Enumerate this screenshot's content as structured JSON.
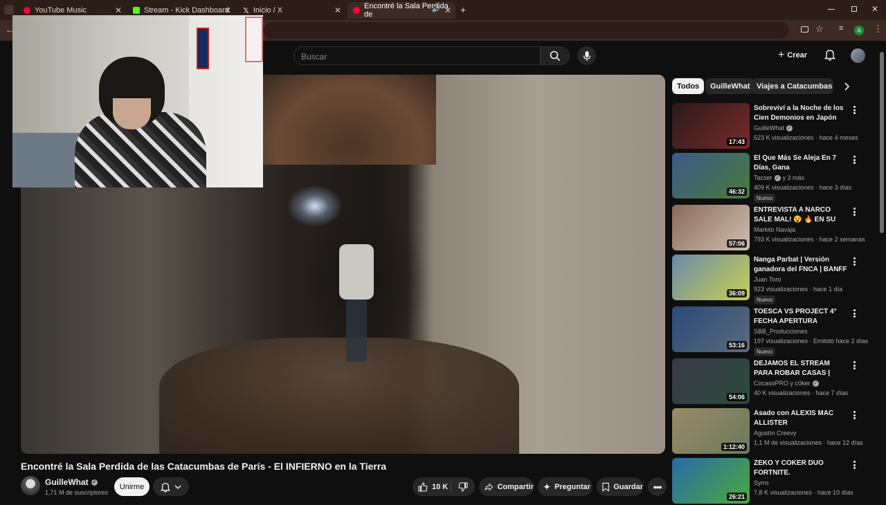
{
  "browser": {
    "tabs": [
      {
        "title": "YouTube Music",
        "color": "#ff0033"
      },
      {
        "title": "Stream - Kick Dashboard",
        "color": "#53fc18"
      },
      {
        "title": "Inicio / X",
        "color": "#ffffff"
      },
      {
        "title": "Encontré la Sala Perdida de",
        "color": "#ff0033"
      }
    ],
    "new_tab": "+"
  },
  "header": {
    "search_placeholder": "Buscar",
    "crear_label": "Crear"
  },
  "video": {
    "title": "Encontré la Sala Perdida de las Catacumbas de París - El INFIERNO en la Tierra",
    "channel": "GuilleWhat",
    "subscribers": "1,71 M de suscriptores",
    "join_label": "Unirme",
    "likes": "10 K",
    "share_label": "Compartir",
    "ask_label": "Preguntar",
    "save_label": "Guardar"
  },
  "chips": [
    "Todos",
    "GuilleWhat",
    "Viajes a Catacumbas de P"
  ],
  "recommendations": [
    {
      "title": "Sobreviví a la Noche de los Cien Demonios en Japón",
      "channel": "GuilleWhat",
      "verified": true,
      "meta": "523 K visualizaciones · hace 4 meses",
      "duration": "17:43",
      "badge": "",
      "thumb": [
        "#2a1a1a",
        "#7a2a2a"
      ]
    },
    {
      "title": "El Que Más Se Aleja En 7 Días, Gana",
      "channel": "Tacser",
      "verified": true,
      "channel_extra": "y 3 más",
      "meta": "409 K visualizaciones · hace 3 días",
      "duration": "46:32",
      "badge": "Nuevo",
      "thumb": [
        "#3a5a8a",
        "#4a7a3a"
      ]
    },
    {
      "title": "ENTREVISTA A NARCO SALE MAL! 😵 🔥 EN SU PROPIA ...",
      "channel": "Markito Navaja",
      "verified": false,
      "meta": "793 K visualizaciones · hace 2 semanas",
      "duration": "57:06",
      "badge": "",
      "thumb": [
        "#8a6a5a",
        "#d0c0b0"
      ]
    },
    {
      "title": "Nanga Parbat | Versión ganadora del FNCA | BANFF ...",
      "channel": "Juan Toro",
      "verified": false,
      "meta": "923 visualizaciones · hace 1 día",
      "duration": "36:09",
      "badge": "Nuevo",
      "thumb": [
        "#6a8aaa",
        "#c8d050"
      ]
    },
    {
      "title": "TOESCA VS PROJECT 4° FECHA APERTURA",
      "channel": "SBB_Producciones",
      "verified": false,
      "meta": "197 visualizaciones · Emitido hace 2 días",
      "duration": "53:16",
      "badge": "Nuevo",
      "thumb": [
        "#2a4a7a",
        "#5a6a7a"
      ]
    },
    {
      "title": "DEJAMOS EL STREAM PARA ROBAR CASAS | CRIME ...",
      "channel": "CocasoPRO y c0ker",
      "verified": true,
      "meta": "40 K visualizaciones · hace 7 días",
      "duration": "54:06",
      "badge": "",
      "thumb": [
        "#3a3a4a",
        "#2a4a3a"
      ]
    },
    {
      "title": "Asado con ALEXIS MAC ALLISTER",
      "channel": "Agustín Creevy",
      "verified": false,
      "meta": "1,1 M de visualizaciones · hace 12 días",
      "duration": "1:12:40",
      "badge": "",
      "thumb": [
        "#9a8a6a",
        "#6a7a5a"
      ]
    },
    {
      "title": "ZEKO Y COKER DUO FORTNITE.",
      "channel": "Syrro",
      "verified": false,
      "meta": "7,8 K visualizaciones · hace 10 días",
      "duration": "26:21",
      "badge": "",
      "thumb": [
        "#2a6aaa",
        "#4aaa3a"
      ]
    }
  ]
}
